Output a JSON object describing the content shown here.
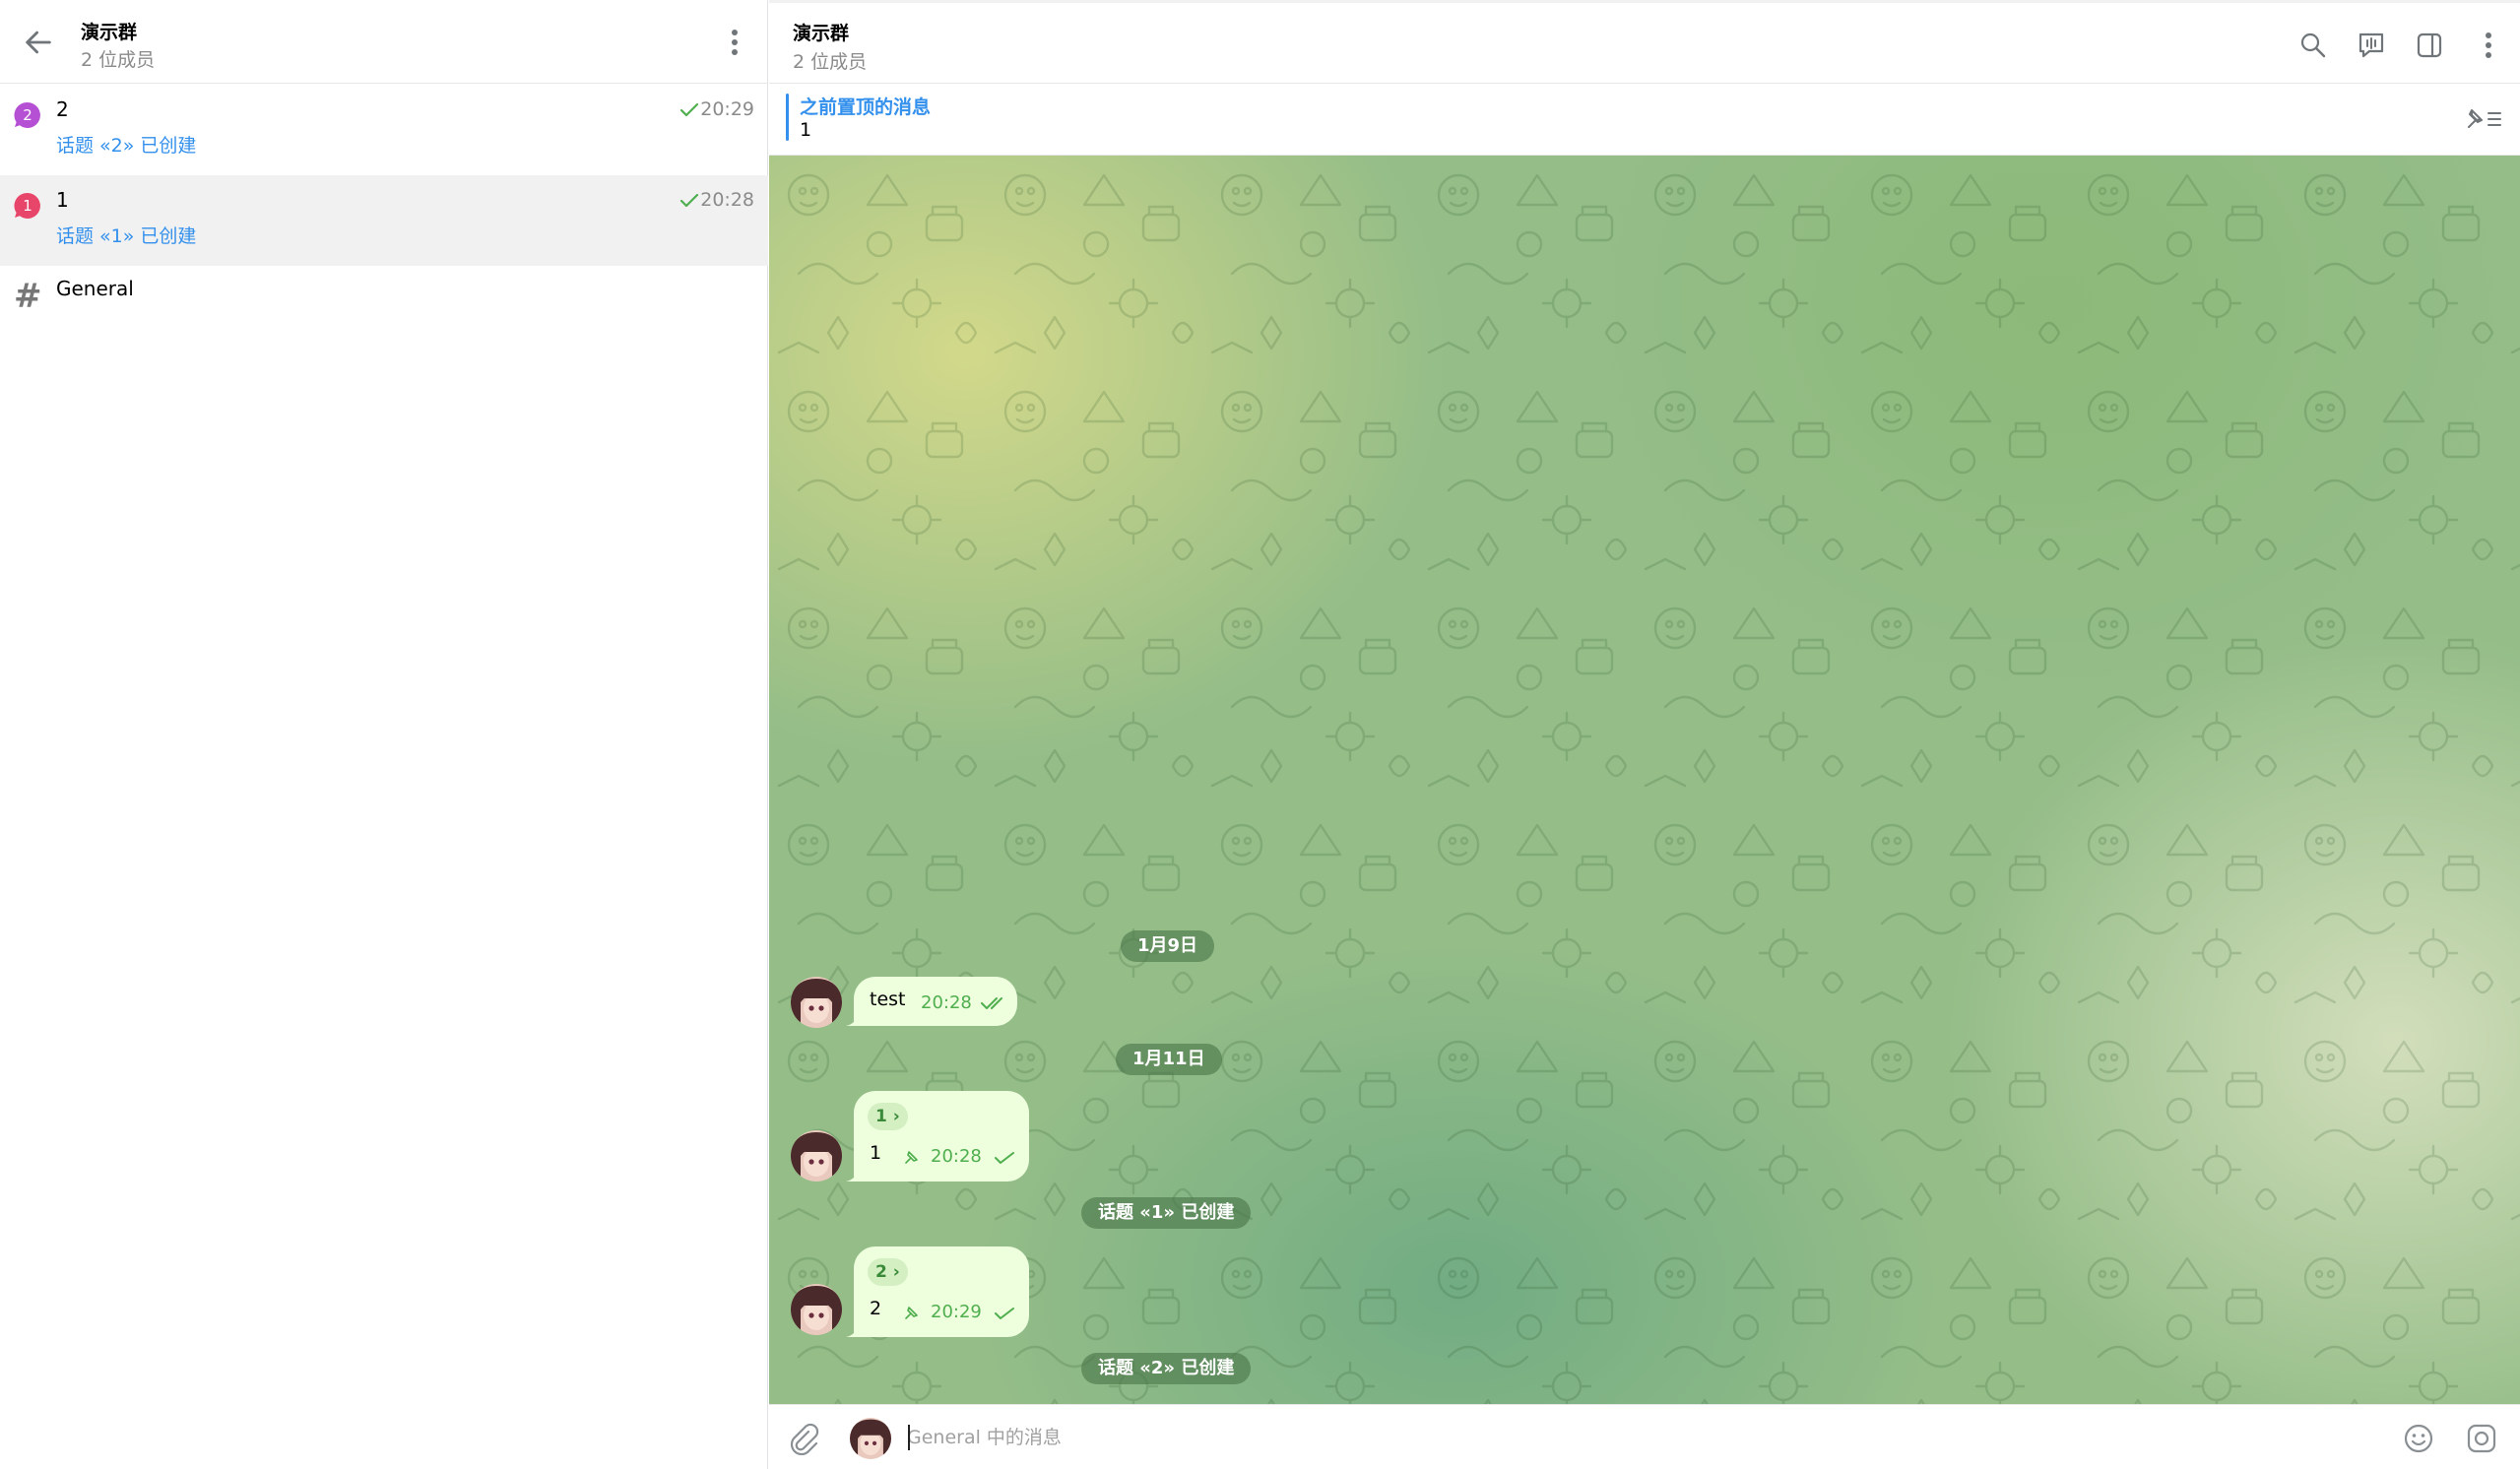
{
  "left_header": {
    "title": "演示群",
    "subtitle": "2 位成员"
  },
  "topics": [
    {
      "name": "2",
      "preview": "话题 «2» 已创建",
      "time": "20:29",
      "icon_color": "#b54fd3",
      "icon_number": "2"
    },
    {
      "name": "1",
      "preview": "话题 «1» 已创建",
      "time": "20:28",
      "icon_color": "#e8456a",
      "icon_number": "1"
    },
    {
      "name": "General",
      "icon": "hash-icon"
    }
  ],
  "right_header": {
    "title": "演示群",
    "subtitle": "2 位成员"
  },
  "pinned": {
    "title": "之前置顶的消息",
    "text": "1"
  },
  "chat": {
    "date_1": "1月9日",
    "msg_test": {
      "text": "test",
      "time": "20:28"
    },
    "date_2": "1月11日",
    "msg_1": {
      "chip": "1 ›",
      "text": "1",
      "time": "20:28"
    },
    "service_1": "话题 «1» 已创建",
    "msg_2": {
      "chip": "2 ›",
      "text": "2",
      "time": "20:29"
    },
    "service_2": "话题 «2» 已创建"
  },
  "composer": {
    "placeholder": "General 中的消息"
  },
  "colors": {
    "accent": "#3390ec",
    "bubble": "#eeffde",
    "time_green": "#4fae4e"
  }
}
